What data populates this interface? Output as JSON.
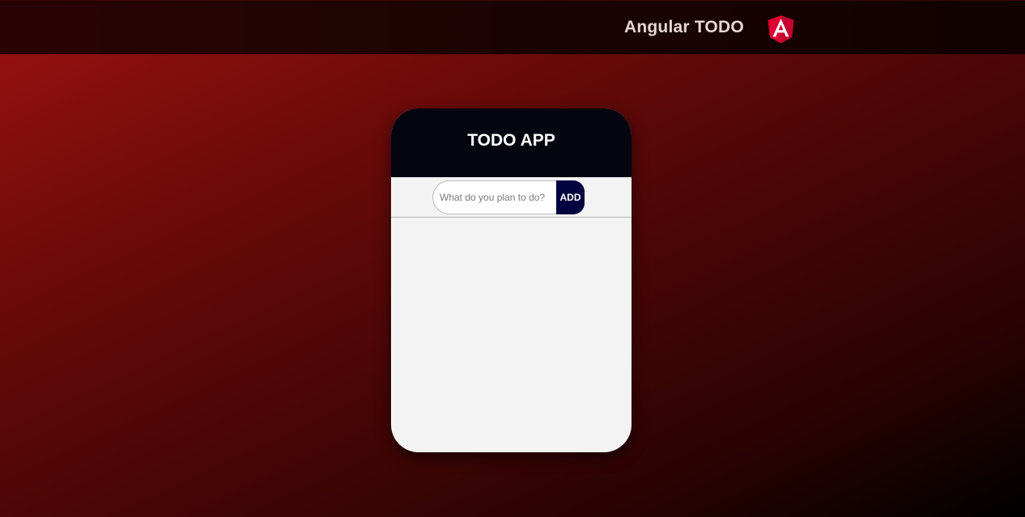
{
  "header": {
    "title": "Angular TODO",
    "logo_icon": "angular-logo-icon",
    "logo_letter": "A",
    "logo_colors": {
      "left": "#dd0031",
      "right": "#c3002f",
      "letter": "#ffffff"
    }
  },
  "card": {
    "title": "TODO APP",
    "input": {
      "value": "",
      "placeholder": "What do you plan to do?"
    },
    "add_label": "ADD",
    "items": []
  },
  "colors": {
    "card_header_bg": "#050510",
    "add_button_bg": "#02023e",
    "card_body_bg": "#f3f3f3",
    "background_start": "#9c1210",
    "background_end": "#000000"
  }
}
